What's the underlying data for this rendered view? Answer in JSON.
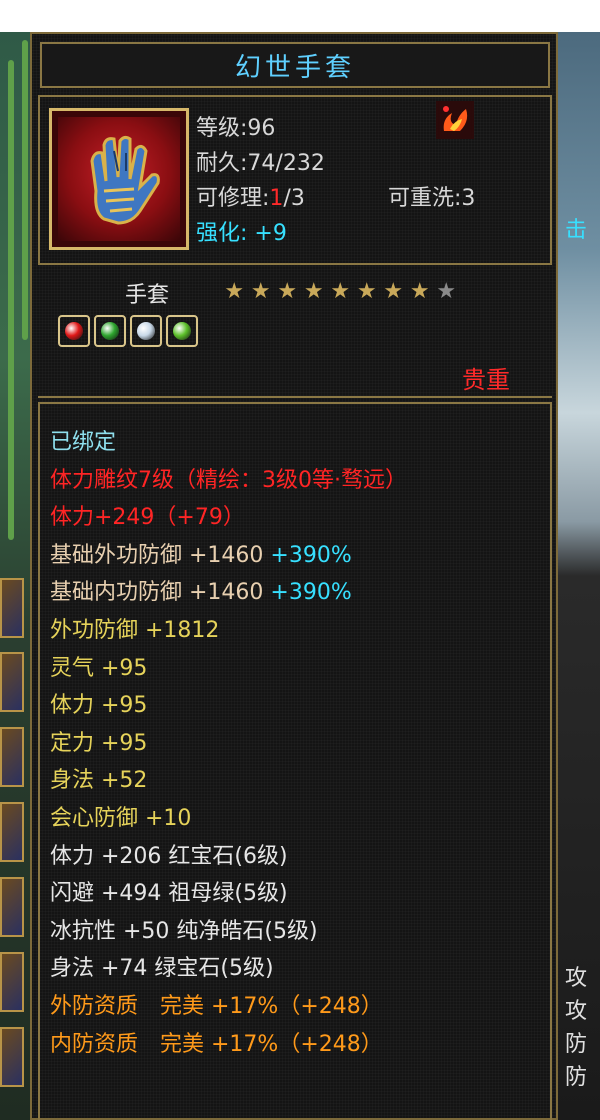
{
  "item": {
    "name": "幻世手套",
    "level_label": "等级:",
    "level": "96",
    "durability_label": "耐久:",
    "durability": "74/232",
    "repair_label": "可修理:",
    "repair_used": "1",
    "repair_max": "/3",
    "rewash_label": "可重洗:",
    "rewash": "3",
    "enhance_label": "强化:",
    "enhance": "+9",
    "type": "手套",
    "stars_filled": 8,
    "stars_total": 9,
    "rarity": "贵重",
    "gem_sockets": [
      {
        "icon": "ruby-gem-icon",
        "color": "#e01818"
      },
      {
        "icon": "emerald-gem-icon",
        "color": "#2ea52e"
      },
      {
        "icon": "diamond-gem-icon",
        "color": "#c8d8e8"
      },
      {
        "icon": "green-gem-icon",
        "color": "#5cc02a"
      }
    ]
  },
  "attributes": [
    {
      "parts": [
        {
          "text": "已绑定",
          "color": "cyan"
        }
      ]
    },
    {
      "parts": [
        {
          "text": "体力雕纹7级（精绘：3级0等·骛远）",
          "color": "red"
        }
      ]
    },
    {
      "parts": [
        {
          "text": "体力+249（+79）",
          "color": "red"
        }
      ]
    },
    {
      "parts": [
        {
          "text": "基础外功防御 +1460 ",
          "color": "tan"
        },
        {
          "text": "+390%",
          "color": "bcyan"
        }
      ]
    },
    {
      "parts": [
        {
          "text": "基础内功防御 +1460 ",
          "color": "tan"
        },
        {
          "text": "+390%",
          "color": "bcyan"
        }
      ]
    },
    {
      "parts": [
        {
          "text": "外功防御 +1812",
          "color": "yel"
        }
      ]
    },
    {
      "parts": [
        {
          "text": "灵气 +95",
          "color": "yel"
        }
      ]
    },
    {
      "parts": [
        {
          "text": "体力 +95",
          "color": "yel"
        }
      ]
    },
    {
      "parts": [
        {
          "text": "定力 +95",
          "color": "yel"
        }
      ]
    },
    {
      "parts": [
        {
          "text": "身法 +52",
          "color": "yel"
        }
      ]
    },
    {
      "parts": [
        {
          "text": "会心防御 +10",
          "color": "yel"
        }
      ]
    },
    {
      "parts": [
        {
          "text": "体力 +206 红宝石(6级)",
          "color": "wht"
        }
      ]
    },
    {
      "parts": [
        {
          "text": "闪避 +494 祖母绿(5级)",
          "color": "wht"
        }
      ]
    },
    {
      "parts": [
        {
          "text": "冰抗性 +50 纯净皓石(5级)",
          "color": "wht"
        }
      ]
    },
    {
      "parts": [
        {
          "text": "身法 +74 绿宝石(5级)",
          "color": "wht"
        }
      ]
    },
    {
      "parts": [
        {
          "text": "外防资质　完美 +17%（+248）",
          "color": "org"
        }
      ]
    },
    {
      "parts": [
        {
          "text": "内防资质　完美 +17%（+248）",
          "color": "org"
        }
      ]
    }
  ],
  "background_fragments": {
    "right_top": "击",
    "right_bottom": [
      "攻",
      "攻",
      "防",
      "防"
    ]
  }
}
